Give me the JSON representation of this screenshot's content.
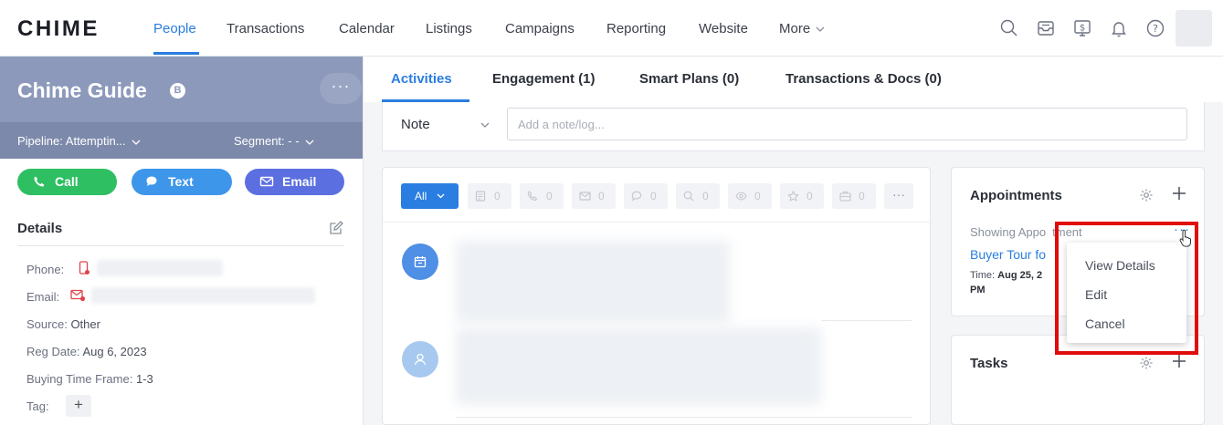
{
  "brand": {
    "logo": "CHIME",
    "accent": "#2a7de1"
  },
  "nav": {
    "items": [
      "People",
      "Transactions",
      "Calendar",
      "Listings",
      "Campaigns",
      "Reporting",
      "Website",
      "More"
    ],
    "active": "People",
    "icons": [
      "search-icon",
      "inbox-icon",
      "dollar-icon",
      "bell-icon",
      "help-icon"
    ]
  },
  "profile": {
    "name": "Chime Guide",
    "badge": "B",
    "more": "···",
    "pipeline_label": "Pipeline:",
    "pipeline_value": "Attemptin...",
    "segment_label": "Segment:",
    "segment_value": "- -",
    "actions": {
      "call": "Call",
      "text": "Text",
      "email": "Email"
    },
    "action_colors": {
      "call": "#2fbf63",
      "text": "#3d96ea",
      "email": "#5b6fe0"
    }
  },
  "details": {
    "title": "Details",
    "phone_label": "Phone:",
    "email_label": "Email:",
    "source_label": "Source:",
    "source_value": "Other",
    "reg_label": "Reg Date:",
    "reg_value": "Aug 6, 2023",
    "btf_label": "Buying Time Frame:",
    "btf_value": "1-3",
    "tag_label": "Tag:",
    "tag_add": "+"
  },
  "tabs": [
    "Activities",
    "Engagement (1)",
    "Smart Plans (0)",
    "Transactions & Docs (0)"
  ],
  "note": {
    "type": "Note",
    "placeholder": "Add a note/log..."
  },
  "filters": {
    "all": "All",
    "chips": [
      {
        "icon": "note-icon",
        "count": "0"
      },
      {
        "icon": "phone-icon",
        "count": "0"
      },
      {
        "icon": "mail-icon",
        "count": "0"
      },
      {
        "icon": "chat-icon",
        "count": "0"
      },
      {
        "icon": "search-icon",
        "count": "0"
      },
      {
        "icon": "eye-icon",
        "count": "0"
      },
      {
        "icon": "star-icon",
        "count": "0"
      },
      {
        "icon": "briefcase-icon",
        "count": "0"
      }
    ],
    "more": "···"
  },
  "appointments": {
    "title": "Appointments",
    "type_text": "Showing Appo",
    "type_text_tail": "tment",
    "dots": "···",
    "link": "Buyer Tour fo",
    "time_label": "Time:",
    "time_value": "Aug 25, 2",
    "time_tail": "PM"
  },
  "tasks": {
    "title": "Tasks"
  },
  "context_menu": {
    "items": [
      "View Details",
      "Edit",
      "Cancel"
    ],
    "highlight_color": "#e10b0b"
  }
}
